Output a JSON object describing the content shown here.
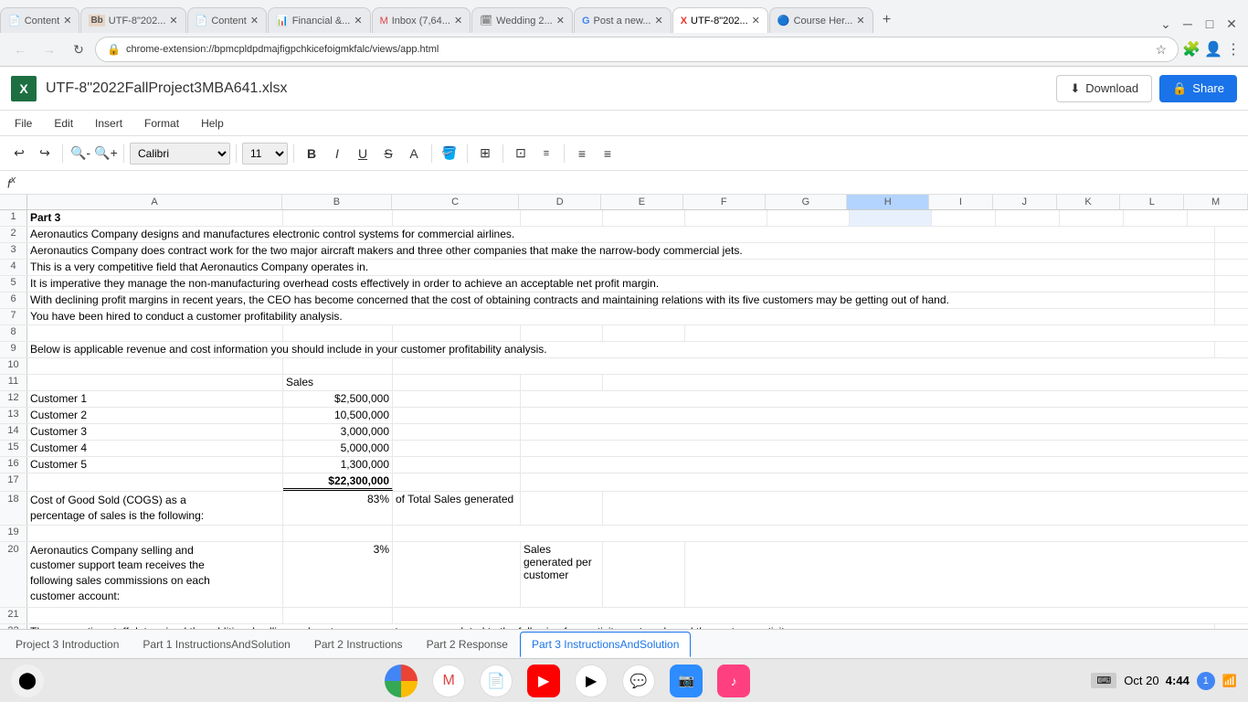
{
  "browser": {
    "tabs": [
      {
        "id": "t1",
        "label": "Content",
        "favicon": "📄",
        "active": false
      },
      {
        "id": "t2",
        "label": "UTF-8\"202...",
        "favicon": "Bb",
        "active": false
      },
      {
        "id": "t3",
        "label": "Content",
        "favicon": "📄",
        "active": false
      },
      {
        "id": "t4",
        "label": "Financial &...",
        "favicon": "📊",
        "active": false
      },
      {
        "id": "t5",
        "label": "Inbox (7,64...",
        "favicon": "M",
        "active": false
      },
      {
        "id": "t6",
        "label": "Wedding 2...",
        "favicon": "🗓",
        "active": false
      },
      {
        "id": "t7",
        "label": "Post a new...",
        "favicon": "G",
        "active": false
      },
      {
        "id": "t8",
        "label": "UTF-8\"202...",
        "favicon": "X",
        "active": true
      },
      {
        "id": "t9",
        "label": "Course Her...",
        "favicon": "🔵",
        "active": false
      }
    ],
    "address": "chrome-extension://bpmcpldpdmajfigpchkicefoigmkfalc/views/app.html"
  },
  "app": {
    "title": "UTF-8\"2022FallProject3MBA641.xlsx",
    "logo": "X",
    "menu": [
      "File",
      "Edit",
      "Insert",
      "Format",
      "Help"
    ],
    "toolbar": {
      "font": "Calibri",
      "size": "11"
    },
    "download_label": "Download",
    "share_label": "Share"
  },
  "spreadsheet": {
    "col_headers": [
      "A",
      "B",
      "C",
      "D",
      "E",
      "F",
      "G",
      "H",
      "I",
      "J",
      "K",
      "L",
      "M"
    ],
    "rows": [
      {
        "num": 1,
        "cells": {
          "A": {
            "v": "Part 3",
            "bold": true
          },
          "B": "",
          "C": "",
          "D": "",
          "E": "",
          "F": "",
          "G": "",
          "H": "",
          "I": "",
          "J": "",
          "K": "",
          "L": "",
          "M": ""
        }
      },
      {
        "num": 2,
        "cells": {
          "A": {
            "v": "Aeronautics Company designs and manufactures electronic control systems for commercial airlines.",
            "colspan": true
          },
          "B": "",
          "C": "",
          "D": "",
          "E": "",
          "F": "",
          "G": "",
          "H": "",
          "I": "",
          "J": "",
          "K": "",
          "L": "",
          "M": ""
        }
      },
      {
        "num": 3,
        "cells": {
          "A": {
            "v": "Aeronautics Company does contract work for the two major aircraft makers and three other companies that make the narrow-body commercial jets.",
            "colspan": true
          },
          "B": "",
          "C": "",
          "D": "",
          "E": "",
          "F": "",
          "G": "",
          "H": "",
          "I": "",
          "J": "",
          "K": "",
          "L": "",
          "M": ""
        }
      },
      {
        "num": 4,
        "cells": {
          "A": {
            "v": "This is a very competitive field that Aeronautics Company operates in.",
            "colspan": true
          },
          "B": "",
          "C": "",
          "D": "",
          "E": "",
          "F": "",
          "G": "",
          "H": "",
          "I": "",
          "J": "",
          "K": "",
          "L": "",
          "M": ""
        }
      },
      {
        "num": 5,
        "cells": {
          "A": {
            "v": "It is imperative they manage the non-manufacturing overhead costs effectively in order to achieve an acceptable net profit margin.",
            "colspan": true
          },
          "B": "",
          "C": "",
          "D": "",
          "E": "",
          "F": "",
          "G": "",
          "H": "",
          "I": "",
          "J": "",
          "K": "",
          "L": "",
          "M": ""
        }
      },
      {
        "num": 6,
        "cells": {
          "A": {
            "v": "With declining profit margins in recent years, the CEO has become concerned that the cost of obtaining contracts and maintaining relations with its five customers may be getting out of hand.",
            "colspan": true
          },
          "B": "",
          "C": "",
          "D": "",
          "E": "",
          "F": "",
          "G": "",
          "H": "",
          "I": "",
          "J": "",
          "K": "",
          "L": "",
          "M": ""
        }
      },
      {
        "num": 7,
        "cells": {
          "A": {
            "v": "You have been hired to conduct a customer profitability analysis.",
            "colspan": true
          },
          "B": "",
          "C": "",
          "D": "",
          "E": "",
          "F": "",
          "G": "",
          "H": "",
          "I": "",
          "J": "",
          "K": "",
          "L": "",
          "M": ""
        }
      },
      {
        "num": 8,
        "cells": {
          "A": "",
          "B": "",
          "C": "",
          "D": "",
          "E": "",
          "F": "",
          "G": "",
          "H": "",
          "I": "",
          "J": "",
          "K": "",
          "L": "",
          "M": ""
        }
      },
      {
        "num": 9,
        "cells": {
          "A": {
            "v": "Below is applicable revenue and cost information you should include in your customer profitability analysis.",
            "colspan": true
          },
          "B": "",
          "C": "",
          "D": "",
          "E": "",
          "F": "",
          "G": "",
          "H": "",
          "I": "",
          "J": "",
          "K": "",
          "L": "",
          "M": ""
        }
      },
      {
        "num": 10,
        "cells": {
          "A": "",
          "B": "",
          "C": "",
          "D": "",
          "E": "",
          "F": "",
          "G": "",
          "H": "",
          "I": "",
          "J": "",
          "K": "",
          "L": "",
          "M": ""
        }
      },
      {
        "num": 11,
        "cells": {
          "A": "",
          "B": {
            "v": "Sales"
          },
          "C": "",
          "D": "",
          "E": "",
          "F": "",
          "G": "",
          "H": "",
          "I": "",
          "J": "",
          "K": "",
          "L": "",
          "M": ""
        }
      },
      {
        "num": 12,
        "cells": {
          "A": "Customer 1",
          "B": {
            "v": "$2,500,000",
            "align": "right"
          },
          "C": "",
          "D": "",
          "E": "",
          "F": "",
          "G": "",
          "H": "",
          "I": "",
          "J": "",
          "K": "",
          "L": "",
          "M": ""
        }
      },
      {
        "num": 13,
        "cells": {
          "A": "Customer 2",
          "B": {
            "v": "10,500,000",
            "align": "right"
          },
          "C": "",
          "D": "",
          "E": "",
          "F": "",
          "G": "",
          "H": "",
          "I": "",
          "J": "",
          "K": "",
          "L": "",
          "M": ""
        }
      },
      {
        "num": 14,
        "cells": {
          "A": "Customer 3",
          "B": {
            "v": "3,000,000",
            "align": "right"
          },
          "C": "",
          "D": "",
          "E": "",
          "F": "",
          "G": "",
          "H": "",
          "I": "",
          "J": "",
          "K": "",
          "L": "",
          "M": ""
        }
      },
      {
        "num": 15,
        "cells": {
          "A": "Customer 4",
          "B": {
            "v": "5,000,000",
            "align": "right"
          },
          "C": "",
          "D": "",
          "E": "",
          "F": "",
          "G": "",
          "H": "",
          "I": "",
          "J": "",
          "K": "",
          "L": "",
          "M": ""
        }
      },
      {
        "num": 16,
        "cells": {
          "A": "Customer 5",
          "B": {
            "v": "1,300,000",
            "align": "right"
          },
          "C": "",
          "D": "",
          "E": "",
          "F": "",
          "G": "",
          "H": "",
          "I": "",
          "J": "",
          "K": "",
          "L": "",
          "M": ""
        }
      },
      {
        "num": 17,
        "cells": {
          "A": "",
          "B": {
            "v": "$22,300,000",
            "align": "right",
            "underline": true,
            "bold": true
          },
          "C": "",
          "D": "",
          "E": "",
          "F": "",
          "G": "",
          "H": "",
          "I": "",
          "J": "",
          "K": "",
          "L": "",
          "M": ""
        }
      },
      {
        "num": 18,
        "cells": {
          "A": {
            "v": "Cost of Good Sold (COGS)  as a\npercentage of sales is the following:",
            "wrap": true
          },
          "B": {
            "v": "83%",
            "align": "right"
          },
          "C": {
            "v": "of Total Sales generated"
          },
          "D": "",
          "E": "",
          "F": "",
          "G": "",
          "H": "",
          "I": "",
          "J": "",
          "K": "",
          "L": "",
          "M": ""
        }
      },
      {
        "num": 19,
        "cells": {
          "A": "",
          "B": "",
          "C": "",
          "D": "",
          "E": "",
          "F": "",
          "G": "",
          "H": "",
          "I": "",
          "J": "",
          "K": "",
          "L": "",
          "M": ""
        }
      },
      {
        "num": 20,
        "cells": {
          "A": {
            "v": "Aeronautics Company selling and\ncustomer support team receives the\nfollowing sales commissions on each\ncustomer account:",
            "wrap": true
          },
          "B": {
            "v": "3%",
            "align": "right"
          },
          "C": "",
          "D": {
            "v": "Sales generated per customer"
          },
          "E": "",
          "F": "",
          "G": "",
          "H": "",
          "I": "",
          "J": "",
          "K": "",
          "L": "",
          "M": ""
        }
      },
      {
        "num": 21,
        "cells": {
          "A": "",
          "B": "",
          "C": "",
          "D": "",
          "E": "",
          "F": "",
          "G": "",
          "H": "",
          "I": "",
          "J": "",
          "K": "",
          "L": "",
          "M": ""
        }
      },
      {
        "num": 22,
        "cells": {
          "A": {
            "v": "The accounting staff determined the additional selling and customer support expenses related to the following four activity cost pools and the cost per activity.",
            "colspan": true
          },
          "B": "",
          "C": "",
          "D": "",
          "E": "",
          "F": "",
          "G": "",
          "H": "",
          "I": "",
          "J": "",
          "K": "",
          "L": "",
          "M": ""
        }
      }
    ],
    "sheet_tabs": [
      {
        "label": "Project 3 Introduction",
        "active": false
      },
      {
        "label": "Part 1 InstructionsAndSolution",
        "active": false
      },
      {
        "label": "Part 2 Instructions",
        "active": false
      },
      {
        "label": "Part 2 Response",
        "active": false
      },
      {
        "label": "Part 3 InstructionsAndSolution",
        "active": true
      }
    ]
  },
  "taskbar": {
    "date": "Oct 20",
    "time": "4:44",
    "indicator": "1"
  }
}
